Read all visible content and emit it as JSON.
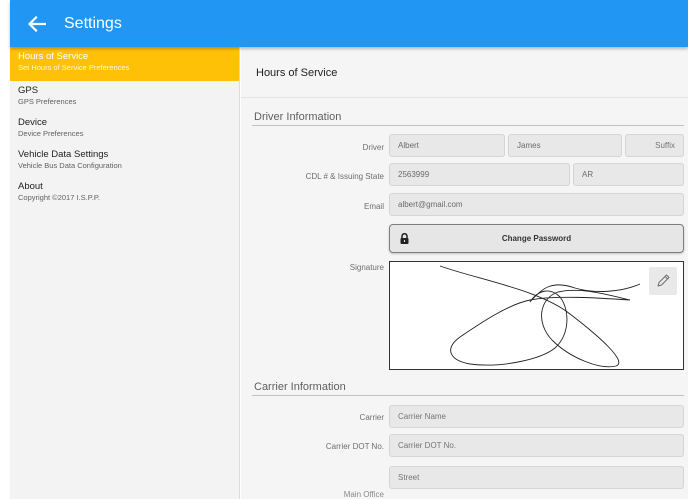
{
  "appbar": {
    "title": "Settings",
    "back_icon": "arrow-left-icon",
    "color": "#2196f3"
  },
  "sidebar": {
    "items": [
      {
        "title": "Hours of Service",
        "subtitle": "Set Hours of Service Preferences",
        "active": true
      },
      {
        "title": "GPS",
        "subtitle": "GPS Preferences",
        "active": false
      },
      {
        "title": "Device",
        "subtitle": "Device Preferences",
        "active": false
      },
      {
        "title": "Vehicle Data Settings",
        "subtitle": "Vehicle Bus Data Configuration",
        "active": false
      },
      {
        "title": "About",
        "subtitle": "Copyright ©2017 I.S.P.P.",
        "active": false
      }
    ],
    "active_color": "#ffc107"
  },
  "main": {
    "header": "Hours of Service",
    "driver_section": {
      "title": "Driver Information",
      "driver_label": "Driver",
      "first_name": "Albert",
      "middle_name": "James",
      "suffix_placeholder": "Suffix",
      "cdl_label": "CDL # & Issuing State",
      "cdl_number": "2563999",
      "cdl_state": "AR",
      "email_label": "Email",
      "email": "albert@gmail.com",
      "change_password_label": "Change Password",
      "signature_label": "Signature",
      "edit_signature_icon": "pencil-icon"
    },
    "carrier_section": {
      "title": "Carrier Information",
      "carrier_label": "Carrier",
      "carrier_placeholder": "Carrier Name",
      "dot_label": "Carrier DOT No.",
      "dot_placeholder": "Carrier DOT No.",
      "main_office_label": "Main Office",
      "street_placeholder": "Street"
    }
  }
}
